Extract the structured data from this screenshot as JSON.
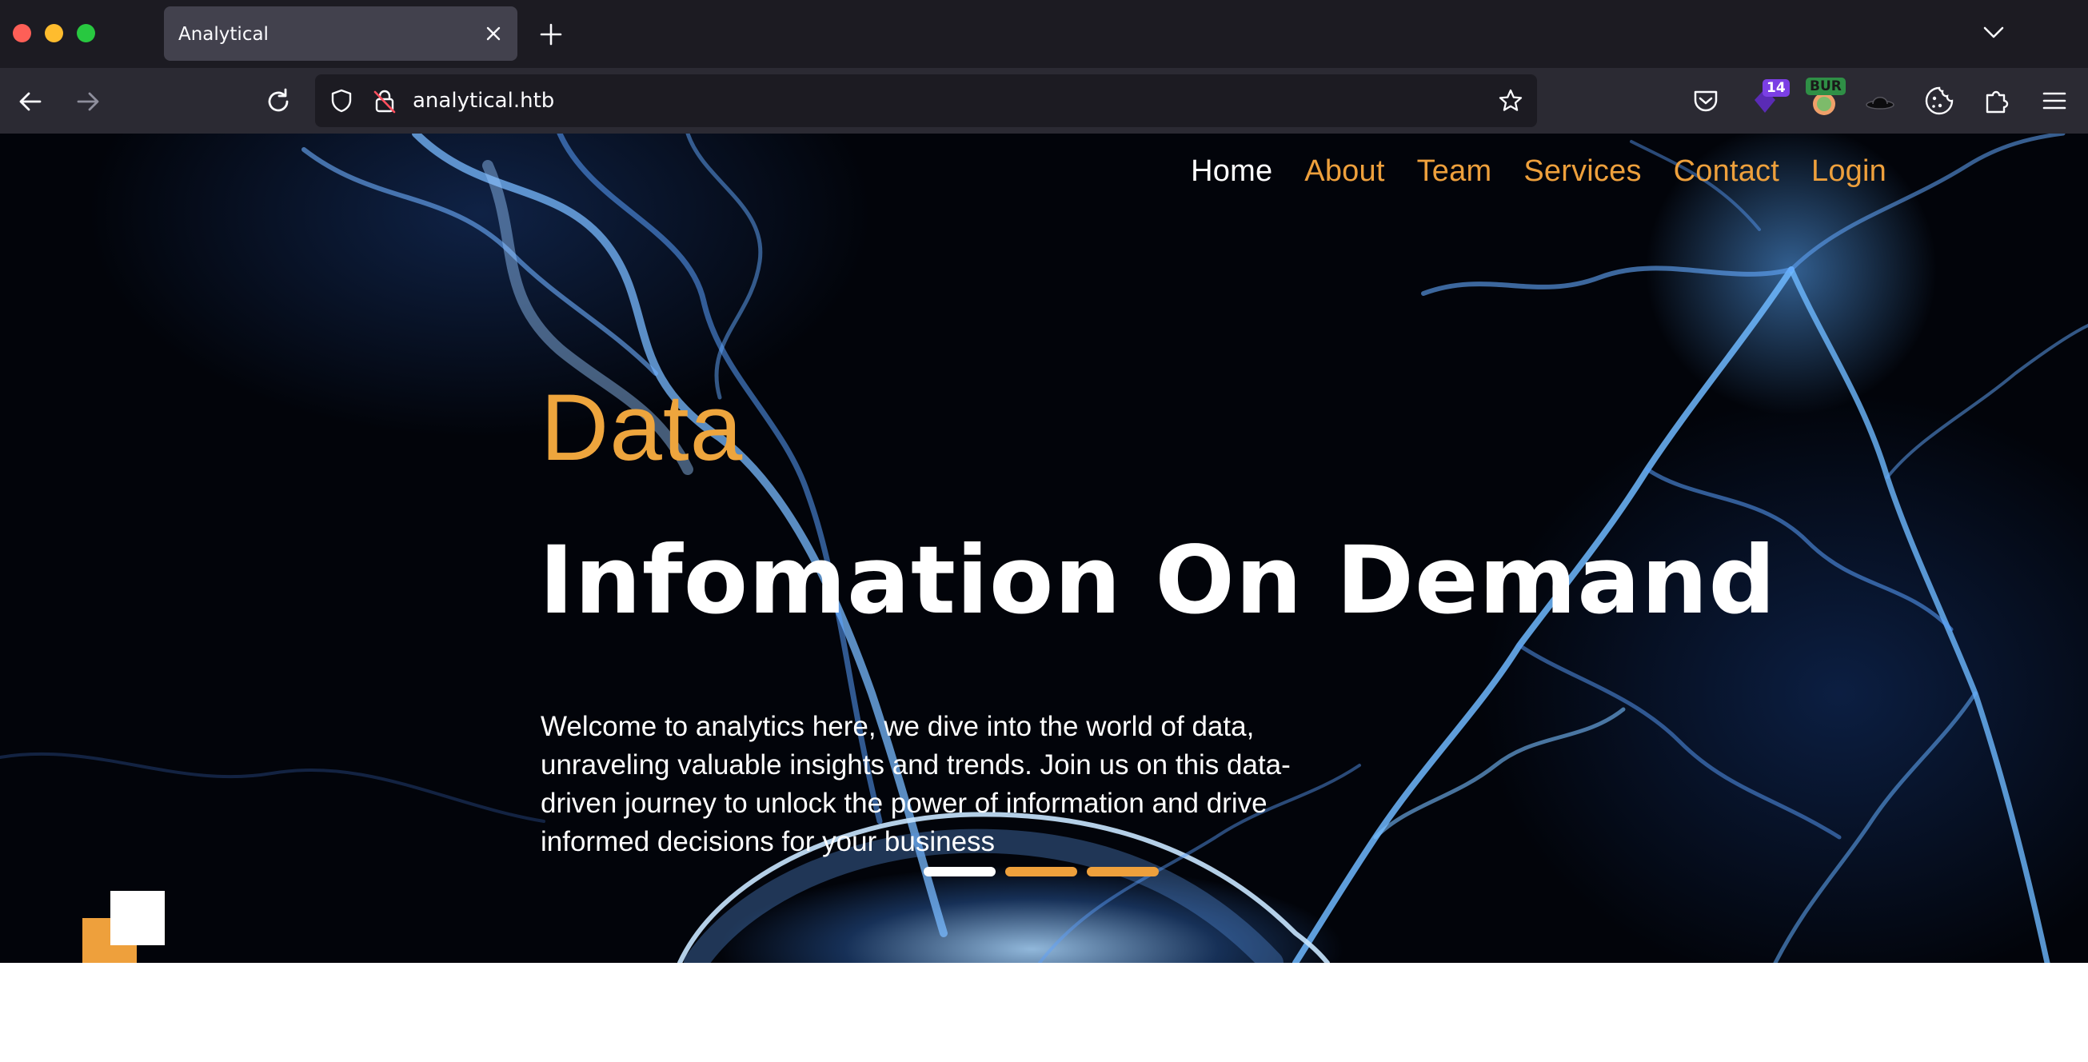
{
  "browser": {
    "tab": {
      "title": "Analytical"
    },
    "address_bar": {
      "url": "analytical.htb"
    },
    "extensions": [
      {
        "icon": "pocket-icon"
      },
      {
        "icon": "ublock-icon",
        "badge": "14"
      },
      {
        "icon": "burp-icon",
        "badge": "BUR"
      },
      {
        "icon": "hat-icon"
      },
      {
        "icon": "cookie-icon"
      },
      {
        "icon": "puzzle-icon"
      },
      {
        "icon": "hamburger-menu-icon"
      }
    ]
  },
  "site": {
    "nav": [
      {
        "label": "Home",
        "active": true
      },
      {
        "label": "About"
      },
      {
        "label": "Team"
      },
      {
        "label": "Services"
      },
      {
        "label": "Contact"
      },
      {
        "label": "Login"
      }
    ],
    "hero": {
      "kicker": "Data",
      "headline": "Infomation On Demand",
      "lead": "Welcome to analytics here, we dive into the world of data, unraveling valuable insights and trends. Join us on this data-driven journey to unlock the power of information and drive informed decisions for your business",
      "slides": {
        "count": 3,
        "active": 1
      }
    }
  },
  "colors": {
    "accent": "#eea03c",
    "tabbar_bg": "#1c1b22",
    "navbar_bg": "#2b2a33"
  }
}
